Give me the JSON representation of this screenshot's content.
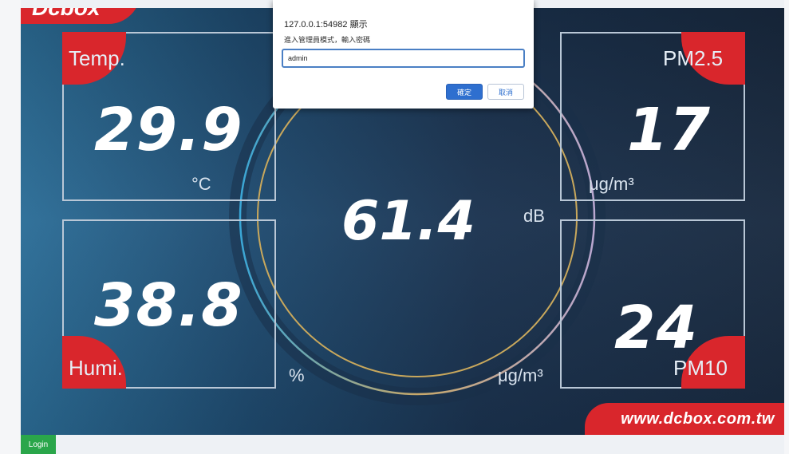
{
  "brand": {
    "logo_text": "Dcbox",
    "website": "www.dcbox.com.tw"
  },
  "colors": {
    "accent_red": "#d9262c",
    "login_green": "#2aa64a",
    "dialog_blue": "#2e6fcf"
  },
  "readings": {
    "temp": {
      "label": "Temp.",
      "value": "29.9",
      "unit": "°C"
    },
    "pm25": {
      "label": "PM2.5",
      "value": "17",
      "unit": "μg/m³"
    },
    "noise": {
      "value": "61.4",
      "unit": "dB"
    },
    "humi": {
      "label": "Humi.",
      "value": "38.8",
      "unit": "%"
    },
    "pm10": {
      "label": "PM10",
      "value": "24",
      "unit": "μg/m³"
    }
  },
  "footer": {
    "login_label": "Login"
  },
  "dialog": {
    "origin_text": "127.0.0.1:54982 顯示",
    "message": "進入管理員模式，輸入密碼",
    "input_value": "admin",
    "ok_label": "確定",
    "cancel_label": "取消"
  }
}
